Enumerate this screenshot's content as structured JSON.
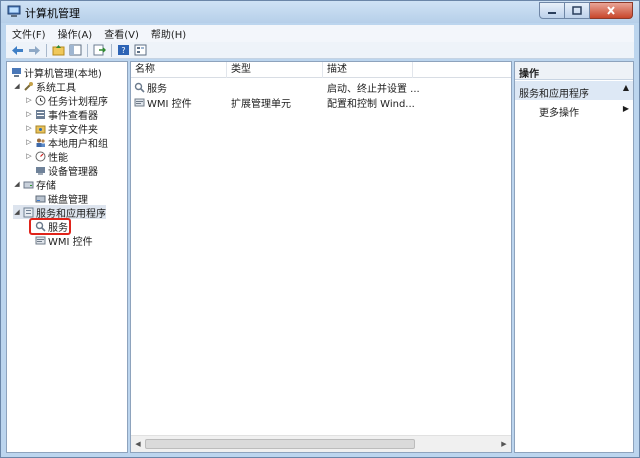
{
  "window": {
    "title": "计算机管理",
    "minimize_icon": "minimize-icon",
    "maximize_icon": "maximize-icon",
    "close_icon": "close-icon"
  },
  "menu": [
    "文件(F)",
    "操作(A)",
    "查看(V)",
    "帮助(H)"
  ],
  "toolbar": {
    "buttons": [
      "back-arrow-icon",
      "forward-arrow-icon",
      "up-folder-icon",
      "show-hide-tree-icon",
      "export-list-icon",
      "help-icon",
      "properties-icon"
    ]
  },
  "tree": {
    "root": "计算机管理(本地)",
    "items": [
      {
        "label": "系统工具",
        "icon": "tools-icon"
      },
      {
        "label": "任务计划程序",
        "icon": "clock-icon"
      },
      {
        "label": "事件查看器",
        "icon": "event-viewer-icon"
      },
      {
        "label": "共享文件夹",
        "icon": "shared-folder-icon"
      },
      {
        "label": "本地用户和组",
        "icon": "users-icon"
      },
      {
        "label": "性能",
        "icon": "performance-icon"
      },
      {
        "label": "设备管理器",
        "icon": "device-manager-icon"
      },
      {
        "label": "存储",
        "icon": "storage-icon"
      },
      {
        "label": "磁盘管理",
        "icon": "disk-icon"
      },
      {
        "label": "服务和应用程序",
        "icon": "services-apps-icon"
      },
      {
        "label": "服务",
        "icon": "services-icon"
      },
      {
        "label": "WMI 控件",
        "icon": "wmi-icon"
      }
    ]
  },
  "list": {
    "columns": [
      "名称",
      "类型",
      "描述"
    ],
    "rows": [
      {
        "name": "服务",
        "type": "",
        "desc": "启动、终止并设置 ..."
      },
      {
        "name": "WMI 控件",
        "type": "扩展管理单元",
        "desc": "配置和控制 Wind..."
      }
    ]
  },
  "actions": {
    "header": "操作",
    "section": "服务和应用程序",
    "more": "更多操作"
  },
  "colors": {
    "highlight_box": "#e0241b",
    "frame": "#bcd5ee"
  }
}
